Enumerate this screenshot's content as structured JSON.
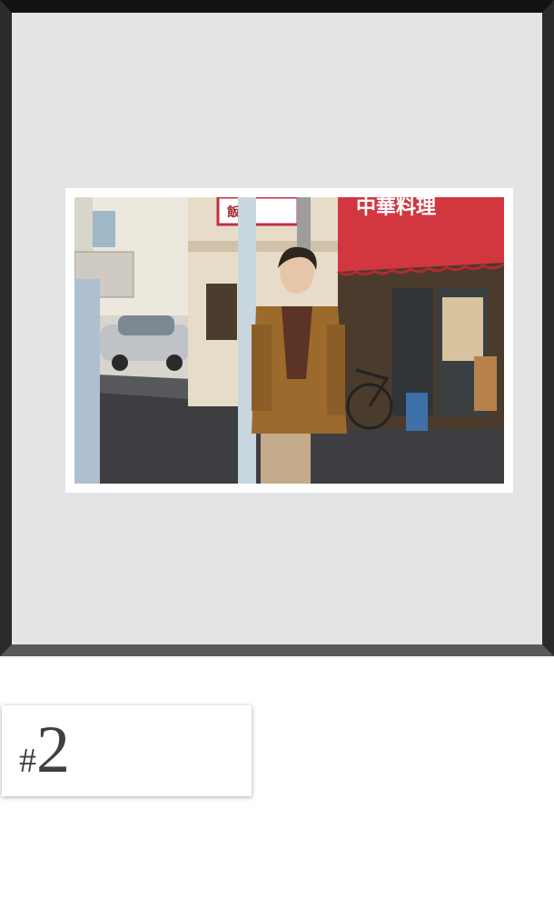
{
  "gallery": {
    "photo": {
      "alt_subject": "person-walking-street-photo",
      "sign_text_awning": "中華料理",
      "sign_text_top": "飯",
      "colors": {
        "awning": "#d2363f",
        "jacket": "#9c6a2c",
        "road": "#3d3e42",
        "wall": "#e6dcc8"
      }
    },
    "frame_colors": {
      "border_top": "#121212",
      "border_side": "#2b2b2b",
      "border_bottom": "#595959",
      "matte_background": "#e3e4e6"
    }
  },
  "caption": {
    "hash": "#",
    "number": "2"
  }
}
